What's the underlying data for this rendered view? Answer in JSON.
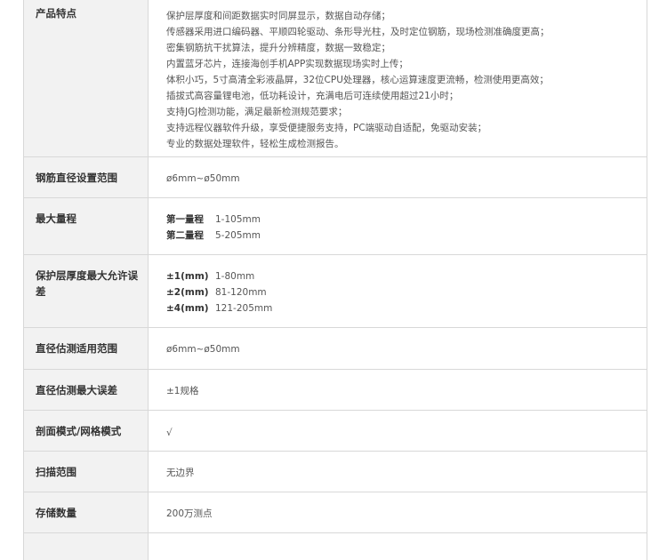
{
  "rows": [
    {
      "label": "产品特点",
      "lines": [
        "保护层厚度和间距数据实时同屏显示，数据自动存储；",
        "传感器采用进口编码器、平顺四轮驱动、条形导光柱，及时定位钢筋，现场检测准确度更高；",
        "密集钢筋抗干扰算法，提升分辨精度，数据一致稳定；",
        "内置蓝牙芯片，连接海创手机APP实现数据现场实时上传；",
        "体积小巧，5寸高清全彩液晶屏，32位CPU处理器，核心运算速度更流畅，检测使用更高效；",
        "插拔式高容量锂电池，低功耗设计，充满电后可连续使用超过21小时；",
        "支持JGJ检测功能，满足最新检测规范要求；",
        "支持远程仪器软件升级，享受便捷服务支持，PC端驱动自适配，免驱动安装；",
        "专业的数据处理软件，轻松生成检测报告。"
      ]
    },
    {
      "label": "钢筋直径设置范围",
      "value": "ø6mm~ø50mm"
    },
    {
      "label": "最大量程",
      "items": [
        {
          "key": "第一量程",
          "value": "1-105mm"
        },
        {
          "key": "第二量程",
          "value": "5-205mm"
        }
      ]
    },
    {
      "label": "保护层厚度最大允许误差",
      "items": [
        {
          "key": "±1(mm)",
          "value": "1-80mm"
        },
        {
          "key": "±2(mm)",
          "value": "81-120mm"
        },
        {
          "key": "±4(mm)",
          "value": "121-205mm"
        }
      ]
    },
    {
      "label": "直径估测适用范围",
      "value": "ø6mm~ø50mm"
    },
    {
      "label": "直径估测最大误差",
      "value": "±1规格"
    },
    {
      "label": "剖面模式/网格模式",
      "value": "√"
    },
    {
      "label": "扫描范围",
      "value": "无边界"
    },
    {
      "label": "存储数量",
      "value": "200万测点"
    }
  ]
}
